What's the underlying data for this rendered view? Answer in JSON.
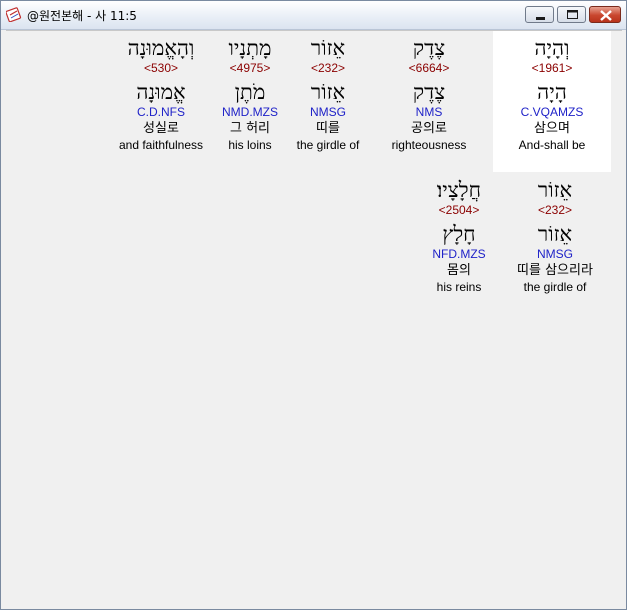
{
  "window": {
    "title": "@원전본해 - 사 11:5",
    "minimize_icon": "minimize-icon",
    "maximize_icon": "maximize-icon",
    "close_icon": "close-icon",
    "app_icon": "bible-app-icon"
  },
  "words": [
    {
      "hebrew": "וְהָיָה",
      "strong": "<1961>",
      "lemma": "הָיָה",
      "parse": "C.VQAMZS",
      "korean": "삼으며",
      "english": "And-shall be"
    },
    {
      "hebrew": "צֶדֶק",
      "strong": "<6664>",
      "lemma": "צֶדֶק",
      "parse": "NMS",
      "korean": "공의로",
      "english": "righteousness"
    },
    {
      "hebrew": "אֵזוֹר",
      "strong": "<232>",
      "lemma": "אֵזוֹר",
      "parse": "NMSG",
      "korean": "띠를",
      "english": "the girdle of"
    },
    {
      "hebrew": "מָתְנָיו",
      "strong": "<4975>",
      "lemma": "מֹתֶן",
      "parse": "NMD.MZS",
      "korean": "그 허리",
      "english": "his loins"
    },
    {
      "hebrew": "וְהָאֱמוּנָה",
      "strong": "<530>",
      "lemma": "אֱמוּנָה",
      "parse": "C.D.NFS",
      "korean": "성실로",
      "english": "and faithfulness"
    },
    {
      "hebrew": "אֵזוֹר",
      "strong": "<232>",
      "lemma": "אֵזוֹר",
      "parse": "NMSG",
      "korean": "띠를 삼으리라",
      "english": "the girdle of"
    },
    {
      "hebrew": "חֲלָצָיו׃",
      "strong": "<2504>",
      "lemma": "חָלָץ",
      "parse": "NFD.MZS",
      "korean": "몸의",
      "english": "his reins"
    }
  ]
}
